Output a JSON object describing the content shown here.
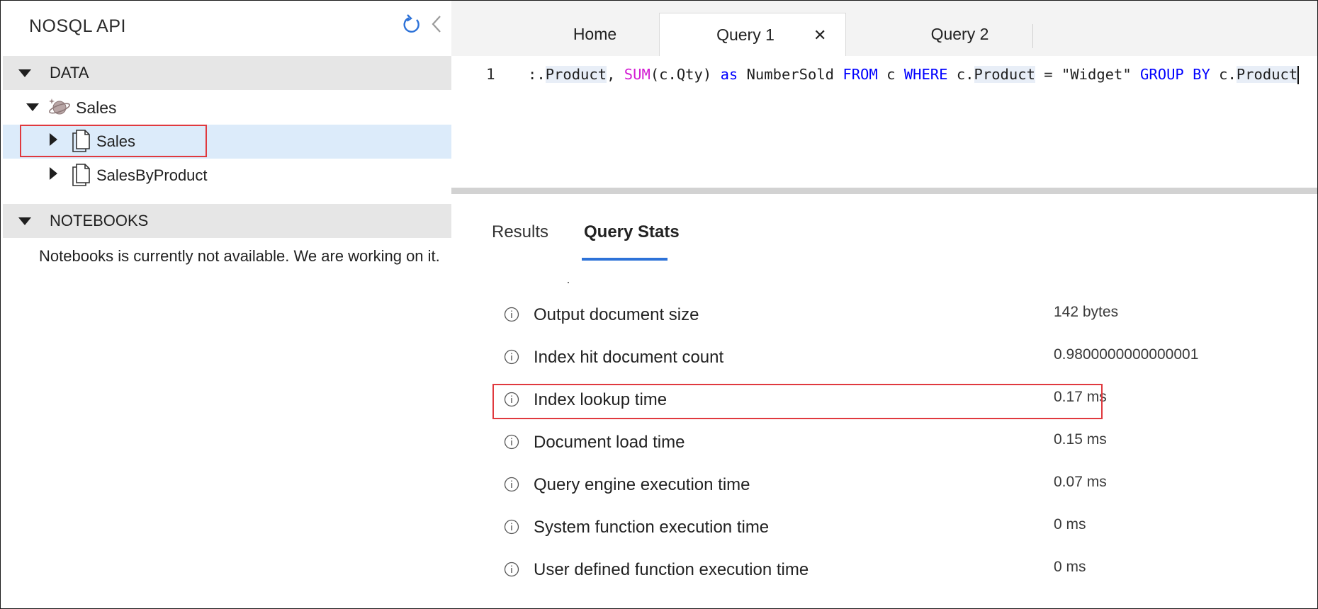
{
  "sidebar": {
    "title": "NOSQL API",
    "refresh_icon": "refresh-icon",
    "collapse_icon": "chevron-left-icon",
    "data_section": "DATA",
    "database": "Sales",
    "containers": [
      "Sales",
      "SalesByProduct"
    ],
    "notebooks_section": "NOTEBOOKS",
    "notebooks_message": "Notebooks is currently not available. We are working on it."
  },
  "tabs": {
    "home": "Home",
    "query1": "Query 1",
    "query1_close": "✕",
    "query2": "Query 2"
  },
  "editor": {
    "line_number": "1",
    "code_tokens": [
      {
        "t": ":.",
        "c": ""
      },
      {
        "t": "Product",
        "c": "hl"
      },
      {
        "t": ", ",
        "c": ""
      },
      {
        "t": "SUM",
        "c": "fn"
      },
      {
        "t": "(c.Qty) ",
        "c": ""
      },
      {
        "t": "as",
        "c": "kw"
      },
      {
        "t": " NumberSold ",
        "c": ""
      },
      {
        "t": "FROM",
        "c": "kw"
      },
      {
        "t": " c ",
        "c": ""
      },
      {
        "t": "WHERE",
        "c": "kw"
      },
      {
        "t": " c.",
        "c": ""
      },
      {
        "t": "Product",
        "c": "hl"
      },
      {
        "t": " = ",
        "c": ""
      },
      {
        "t": "\"Widget\"",
        "c": "str"
      },
      {
        "t": " ",
        "c": ""
      },
      {
        "t": "GROUP BY",
        "c": "kw"
      },
      {
        "t": " c.",
        "c": ""
      },
      {
        "t": "Product",
        "c": "hl"
      }
    ]
  },
  "results": {
    "tab_results": "Results",
    "tab_query_stats": "Query Stats",
    "stats": [
      {
        "label": "Output document size",
        "value": "142 bytes"
      },
      {
        "label": "Index hit document count",
        "value": "0.9800000000000001"
      },
      {
        "label": "Index lookup time",
        "value": "0.17 ms"
      },
      {
        "label": "Document load time",
        "value": "0.15 ms"
      },
      {
        "label": "Query engine execution time",
        "value": "0.07 ms"
      },
      {
        "label": "System function execution time",
        "value": "0 ms"
      },
      {
        "label": "User defined function execution time",
        "value": "0 ms"
      }
    ]
  },
  "colors": {
    "accent": "#2d72d8",
    "highlight_box": "#e0393e",
    "selected_row": "#dcebfa",
    "keyword": "#0000ff",
    "function": "#d31bd3"
  }
}
